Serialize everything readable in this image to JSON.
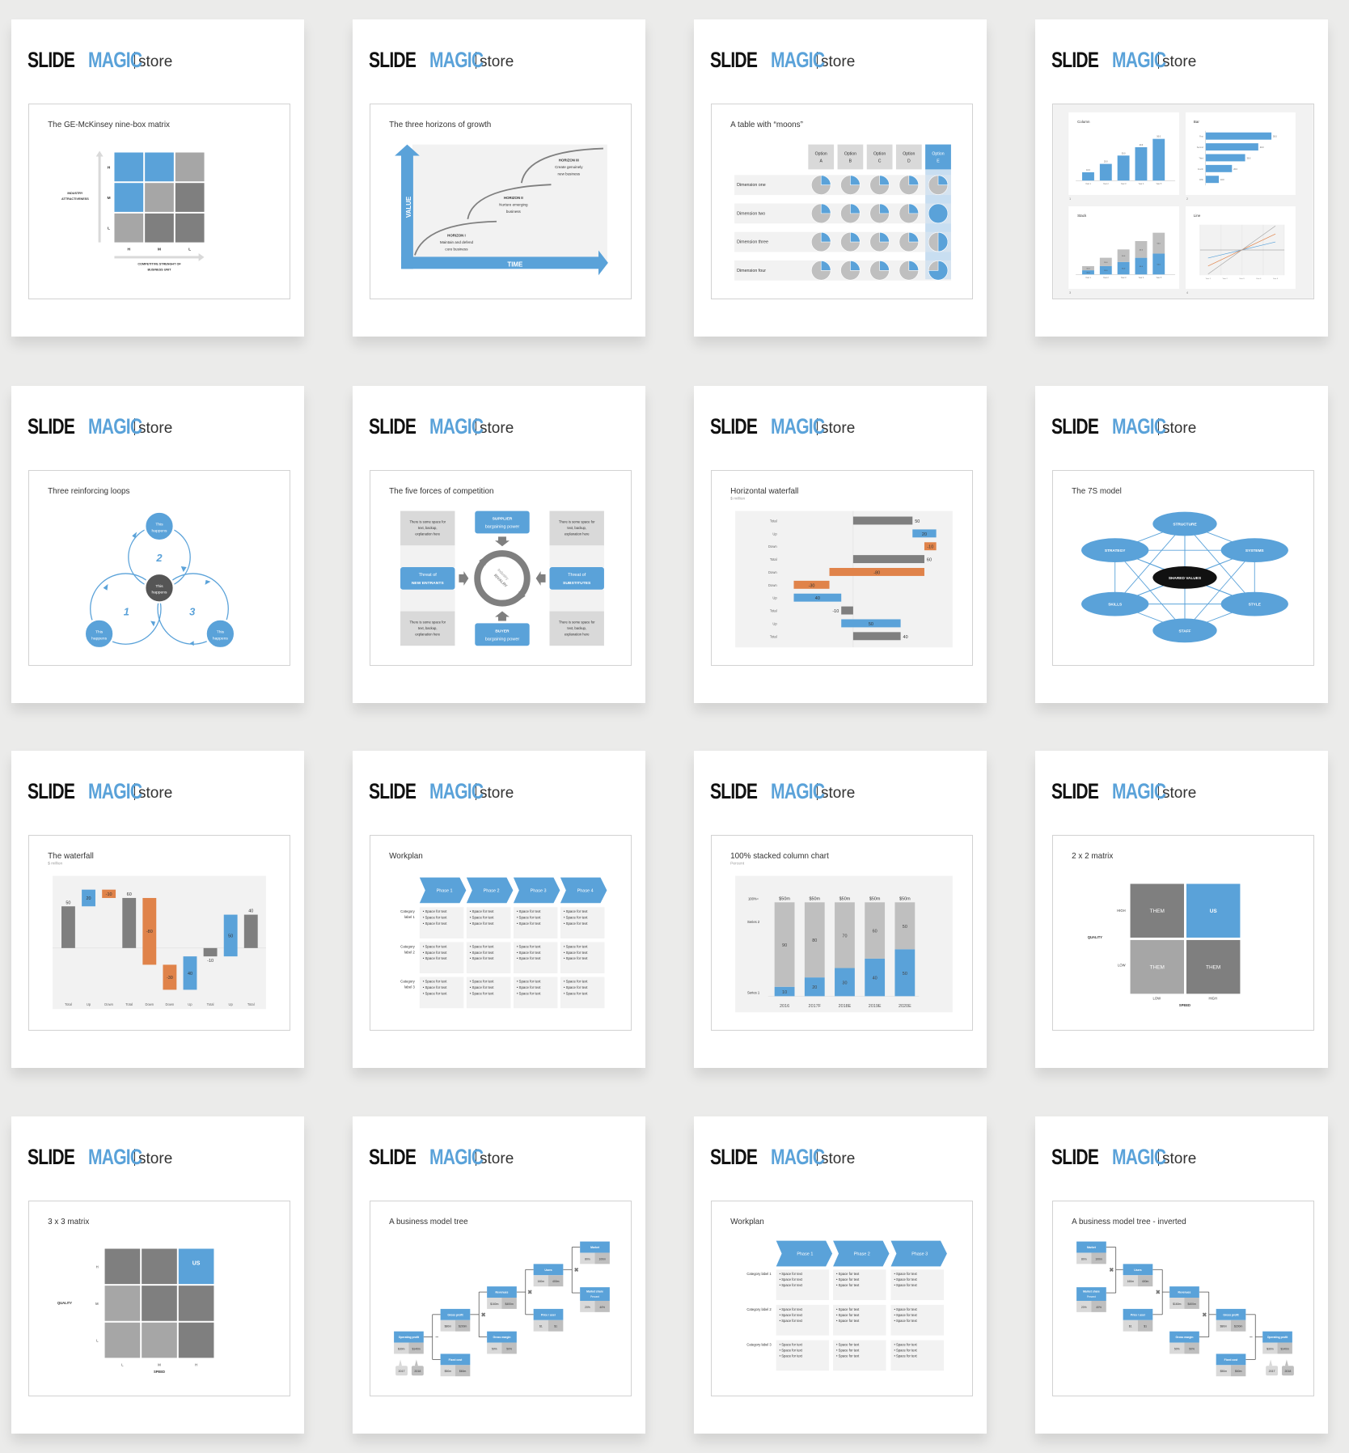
{
  "brand": {
    "slide": "SLIDE",
    "magic": "MAGIC",
    "store": "store"
  },
  "colors": {
    "blue": "#5aa2d9",
    "dark_gray": "#7f7f7f",
    "mid_gray": "#a6a6a6",
    "light_gray": "#d9d9d9",
    "panel_bg": "#f2f2f2",
    "orange": "#e0834a",
    "black": "#111111"
  },
  "business_tree": {
    "operator_minus": "−",
    "operator_times": "✖",
    "years": [
      "2017",
      "2018"
    ],
    "nodes": [
      {
        "label": "Operating profit",
        "values": [
          "$30m",
          "$140m"
        ]
      },
      {
        "label": "Gross profit",
        "values": [
          "$80m",
          "$200m"
        ]
      },
      {
        "label": "Fixed cost",
        "values": [
          "$50m",
          "$60m"
        ]
      },
      {
        "label": "Revenues",
        "values": [
          "$160m",
          "$400m"
        ]
      },
      {
        "label": "Gross margin",
        "values": [
          "50%",
          "50%"
        ]
      },
      {
        "label": "Users",
        "values": [
          "160m",
          "400m"
        ]
      },
      {
        "label": "Price / user",
        "values": [
          "$1",
          "$1"
        ]
      },
      {
        "label": "Market",
        "values": [
          "80m",
          "100m"
        ]
      },
      {
        "label": "Market share",
        "sub": "Percent",
        "values": [
          "20%",
          "40%"
        ]
      }
    ]
  },
  "workplan_text": "• Space for text",
  "cards": [
    {
      "type": "ninebox",
      "title": "The GE-McKinsey nine-box matrix",
      "row_labels": [
        "H",
        "M",
        "L"
      ],
      "col_labels": [
        "H",
        "M",
        "L"
      ],
      "y_axis": [
        "INDUSTRY",
        "ATTRACTIVENESS"
      ],
      "x_axis": [
        "COMPETITIVE STRENGHT OF",
        "BUSINESS UNIT"
      ],
      "cells": [
        [
          "blue",
          "blue",
          "mid"
        ],
        [
          "blue",
          "mid",
          "dark"
        ],
        [
          "mid",
          "dark",
          "dark"
        ]
      ]
    },
    {
      "type": "horizons",
      "title": "The three horizons of growth",
      "y_axis": "VALUE",
      "x_axis": "TIME",
      "horizons": [
        {
          "name": "HORIZON I",
          "lines": [
            "Maintain and defend",
            "core business"
          ]
        },
        {
          "name": "HORIZON II",
          "lines": [
            "Nurture emerging",
            "business"
          ]
        },
        {
          "name": "HORIZON III",
          "lines": [
            "Create genuinely",
            "new business"
          ]
        }
      ]
    },
    {
      "type": "moons",
      "title": "A table with “moons”",
      "options": [
        [
          "Option",
          "A"
        ],
        [
          "Option",
          "B"
        ],
        [
          "Option",
          "C"
        ],
        [
          "Option",
          "D"
        ],
        [
          "Option",
          "E"
        ]
      ],
      "highlighted_option": 4,
      "rows": [
        {
          "label": "Dimension one",
          "fill": [
            0.25,
            0.25,
            0.25,
            0.25,
            0.25
          ]
        },
        {
          "label": "Dimension two",
          "fill": [
            0.25,
            0.25,
            0.25,
            0.25,
            1.0
          ]
        },
        {
          "label": "Dimension three",
          "fill": [
            0.25,
            0.25,
            0.25,
            0.25,
            0.5
          ]
        },
        {
          "label": "Dimension four",
          "fill": [
            0.25,
            0.25,
            0.25,
            0.25,
            0.75
          ]
        }
      ]
    },
    {
      "type": "charts",
      "numbers": [
        "1",
        "2",
        "3",
        "4"
      ],
      "column": {
        "title": "Column",
        "categories": [
          "Year 1",
          "Year 2",
          "Year 3",
          "Year 4",
          "Year 5"
        ],
        "values": [
          10,
          20,
          30,
          40,
          50
        ],
        "labels": [
          "10.0",
          "20.0",
          "30.0",
          "40.0",
          "50.0"
        ]
      },
      "bar": {
        "title": "Bar",
        "categories": [
          "First",
          "Second",
          "Third",
          "Fourth",
          "Fifth"
        ],
        "values": [
          50,
          40,
          30,
          20,
          10
        ],
        "labels": [
          "50.0",
          "40.0",
          "30.0",
          "20.0",
          "10.0"
        ]
      },
      "stack": {
        "title": "Stack",
        "categories": [
          "Year 1",
          "Year 2",
          "Year 3",
          "Year 4",
          "Year 5"
        ],
        "series1": [
          10,
          20,
          30,
          40,
          50
        ],
        "series2": [
          10,
          20,
          30,
          40,
          50
        ],
        "labels": [
          "10.0",
          "20.0",
          "30.0",
          "40.0",
          "50.0"
        ]
      },
      "line": {
        "title": "Line",
        "categories": [
          "Year 1",
          "Year 2",
          "Year 3",
          "Year 4",
          "Year 5"
        ],
        "series": [
          [
            -2,
            -1,
            0,
            1,
            2
          ],
          [
            -4,
            -2,
            0,
            2,
            4
          ],
          [
            -6,
            -3,
            0,
            3,
            6
          ]
        ],
        "series_colors": [
          "#5aa2d9",
          "#e0834a",
          "#a6a6a6"
        ],
        "ylim": [
          -6,
          6
        ]
      }
    },
    {
      "type": "loops",
      "title": "Three reinforcing loops",
      "node_text": [
        "This",
        "happens"
      ],
      "loop_numbers": [
        "1",
        "2",
        "3"
      ]
    },
    {
      "type": "fiveforces",
      "title": "The five forces of competition",
      "note": [
        "There is some space for",
        "text, backup,",
        "explanation here"
      ],
      "supplier": [
        "SUPPLIER",
        "bargaining power"
      ],
      "buyer": [
        "BUYER",
        "bargaining power"
      ],
      "entrants": [
        "Threat of",
        "NEW ENTRANTS"
      ],
      "substitutes": [
        "Threat of",
        "SUBSTITUTES"
      ],
      "center": [
        "Industry",
        "RIVALRY"
      ]
    },
    {
      "type": "hwaterfall",
      "title": "Horizontal waterfall",
      "subtitle": "$ million",
      "steps": [
        {
          "label": "Total",
          "kind": "total",
          "value": 50
        },
        {
          "label": "Up",
          "kind": "up",
          "value": 20
        },
        {
          "label": "Down",
          "kind": "down",
          "value": -10
        },
        {
          "label": "Total",
          "kind": "total",
          "value": 60
        },
        {
          "label": "Down",
          "kind": "down",
          "value": -80
        },
        {
          "label": "Down",
          "kind": "down",
          "value": -30
        },
        {
          "label": "Up",
          "kind": "up",
          "value": 40
        },
        {
          "label": "Total",
          "kind": "total",
          "value": -10
        },
        {
          "label": "Up",
          "kind": "up",
          "value": 50
        },
        {
          "label": "Total",
          "kind": "total",
          "value": 40
        }
      ]
    },
    {
      "type": "sevens",
      "title": "The 7S model",
      "elements": [
        "STRUCTURE",
        "STRATEGY",
        "SYSTEMS",
        "SKILLS",
        "STYLE",
        "STAFF"
      ],
      "center": "SHARED VALUES"
    },
    {
      "type": "waterfall",
      "title": "The waterfall",
      "subtitle": "$ million",
      "steps": [
        {
          "label": "Total",
          "kind": "total",
          "value": 50
        },
        {
          "label": "Up",
          "kind": "up",
          "value": 20
        },
        {
          "label": "Down",
          "kind": "down",
          "value": -10
        },
        {
          "label": "Total",
          "kind": "total",
          "value": 60
        },
        {
          "label": "Down",
          "kind": "down",
          "value": -80
        },
        {
          "label": "Down",
          "kind": "down",
          "value": -30
        },
        {
          "label": "Up",
          "kind": "up",
          "value": 40
        },
        {
          "label": "Total",
          "kind": "total",
          "value": -10
        },
        {
          "label": "Up",
          "kind": "up",
          "value": 50
        },
        {
          "label": "Total",
          "kind": "total",
          "value": 40
        }
      ]
    },
    {
      "type": "workplan4",
      "title": "Workplan",
      "phases": [
        "Phase 1",
        "Phase 2",
        "Phase 3",
        "Phase 4"
      ],
      "categories": [
        [
          "Category",
          "label 1"
        ],
        [
          "Category",
          "label 2"
        ],
        [
          "Category",
          "label 3"
        ]
      ]
    },
    {
      "type": "stacked",
      "title": "100% stacked column chart",
      "subtitle": "Percent",
      "total_label": "100%=",
      "series_names": [
        "Series 1",
        "Series 2"
      ],
      "categories": [
        "2016",
        "2017F",
        "2018E",
        "2019E",
        "2020E"
      ],
      "totals": [
        "$50m",
        "$50m",
        "$50m",
        "$50m",
        "$50m"
      ],
      "series1": [
        10,
        20,
        30,
        40,
        50
      ],
      "series2": [
        90,
        80,
        70,
        60,
        50
      ]
    },
    {
      "type": "matrix2",
      "title": "2 x 2 matrix",
      "cells": [
        "THEM",
        "US",
        "THEM",
        "THEM"
      ],
      "y_labels": [
        "HIGH",
        "LOW"
      ],
      "x_labels": [
        "LOW",
        "HIGH"
      ],
      "y_axis": "QUALITY",
      "x_axis": "SPEED"
    },
    {
      "type": "matrix3",
      "title": "3 x 3 matrix",
      "us_label": "US",
      "cells": [
        [
          "dark",
          "dark",
          "blue"
        ],
        [
          "mid",
          "dark",
          "dark"
        ],
        [
          "mid",
          "mid",
          "dark"
        ]
      ],
      "y_labels": [
        "H",
        "M",
        "L"
      ],
      "x_labels": [
        "L",
        "M",
        "H"
      ],
      "y_axis": "QUALITY",
      "x_axis": "SPEED"
    },
    {
      "type": "tree",
      "title": "A business model tree"
    },
    {
      "type": "workplan3",
      "title": "Workplan",
      "phases": [
        "Phase 1",
        "Phase 2",
        "Phase 3"
      ],
      "categories": [
        "Category label 1",
        "Category label 2",
        "Category label 3"
      ]
    },
    {
      "type": "treeinv",
      "title": "A business model tree - inverted"
    }
  ]
}
